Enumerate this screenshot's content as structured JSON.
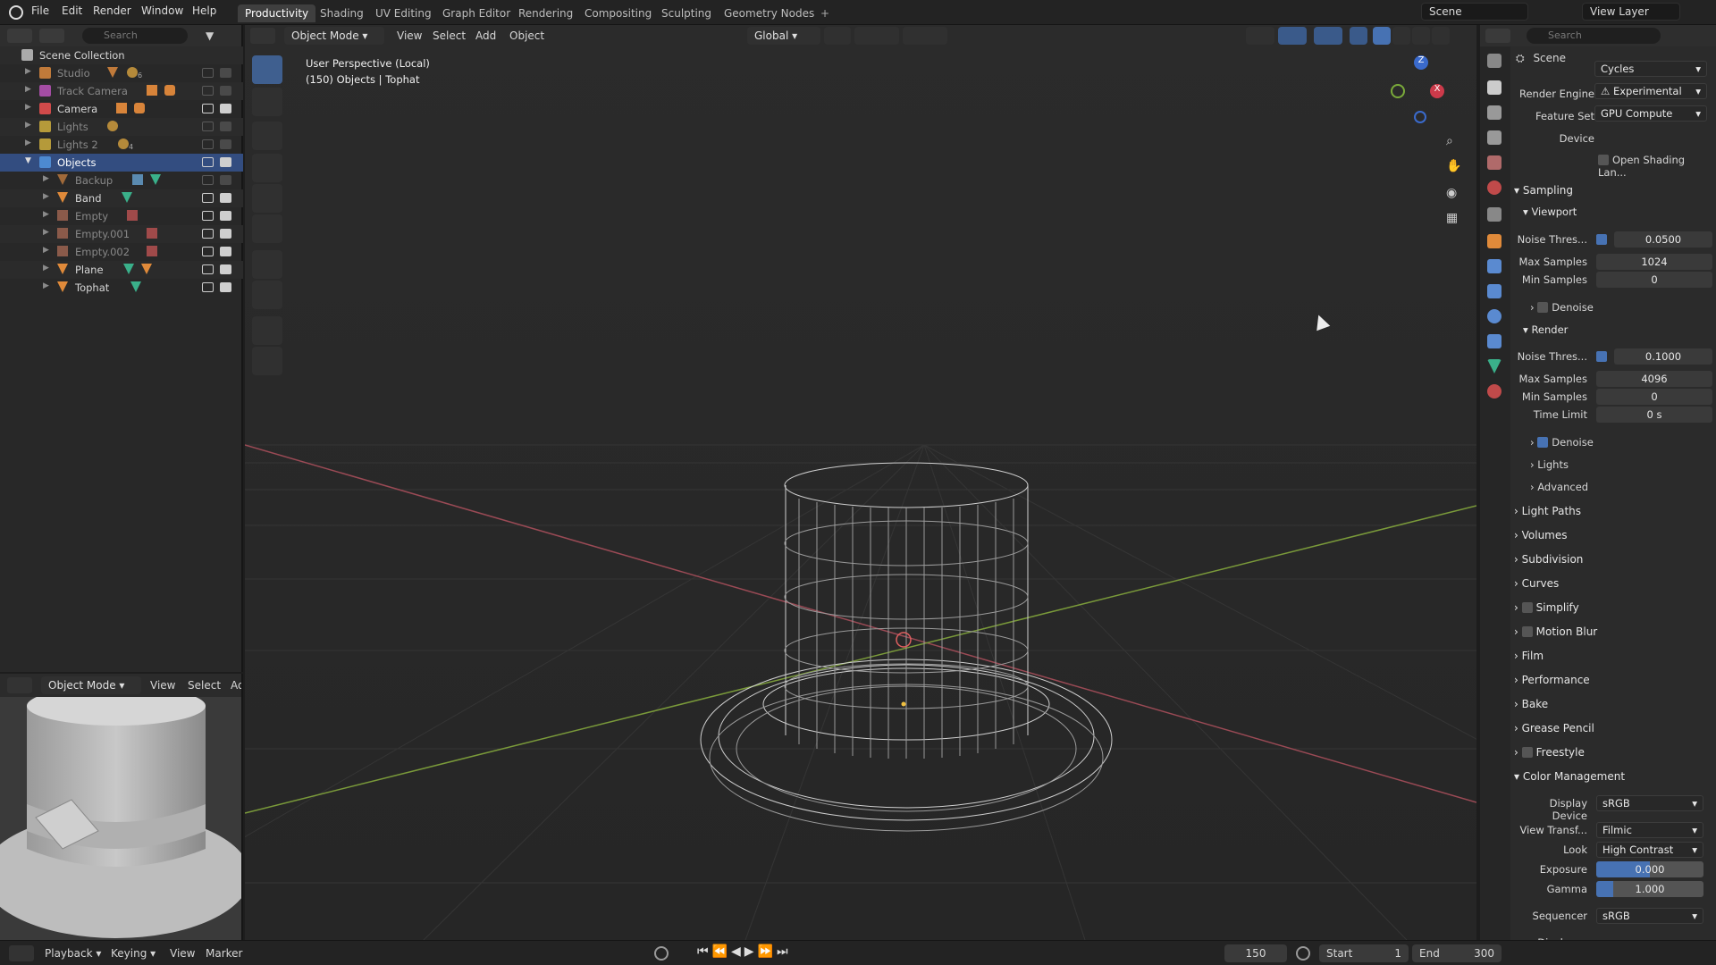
{
  "menu": [
    "File",
    "Edit",
    "Render",
    "Window",
    "Help"
  ],
  "workspaces": [
    "Productivity",
    "Shading",
    "UV Editing",
    "Graph Editor",
    "Rendering",
    "Compositing",
    "Sculpting",
    "Geometry Nodes"
  ],
  "top_right": {
    "scene": "Scene",
    "view_layer": "View Layer"
  },
  "outliner": {
    "search_placeholder": "Search",
    "root": "Scene Collection",
    "collections": [
      {
        "name": "Studio",
        "badge": "6"
      },
      {
        "name": "Track Camera",
        "badge": ""
      },
      {
        "name": "Camera",
        "badge": ""
      },
      {
        "name": "Lights",
        "badge": ""
      },
      {
        "name": "Lights 2",
        "badge": "4"
      },
      {
        "name": "Objects",
        "badge": ""
      }
    ],
    "objects": [
      "Backup",
      "Band",
      "Empty",
      "Empty.001",
      "Empty.002",
      "Plane",
      "Tophat"
    ]
  },
  "mini_view": {
    "mode": "Object Mode",
    "view": "View",
    "select": "Select",
    "add": "Ad"
  },
  "viewport": {
    "mode": "Object Mode",
    "menus": [
      "View",
      "Select",
      "Add",
      "Object"
    ],
    "orientation": "Global",
    "info_line1": "User Perspective (Local)",
    "info_line2": "(150) Objects | Tophat",
    "gizmo": {
      "z": "Z",
      "x": "X"
    }
  },
  "properties": {
    "header": "Scene",
    "search_placeholder": "Search",
    "render_engine_label": "Render Engine",
    "render_engine": "Cycles",
    "feature_set_label": "Feature Set",
    "feature_set": "Experimental",
    "device_label": "Device",
    "device": "GPU Compute",
    "open_shading": "Open Shading Lan...",
    "sampling": "Sampling",
    "viewport": "Viewport",
    "vp_noise_label": "Noise Thres...",
    "vp_noise": "0.0500",
    "vp_max_label": "Max Samples",
    "vp_max": "1024",
    "vp_min_label": "Min Samples",
    "vp_min": "0",
    "denoise": "Denoise",
    "render": "Render",
    "r_noise_label": "Noise Thres...",
    "r_noise": "0.1000",
    "r_max_label": "Max Samples",
    "r_max": "4096",
    "r_min_label": "Min Samples",
    "r_min": "0",
    "time_label": "Time Limit",
    "time": "0 s",
    "r_denoise": "Denoise",
    "lights": "Lights",
    "advanced": "Advanced",
    "sections": [
      "Light Paths",
      "Volumes",
      "Subdivision",
      "Curves",
      "Simplify",
      "Motion Blur",
      "Film",
      "Performance",
      "Bake",
      "Grease Pencil",
      "Freestyle"
    ],
    "color_management": "Color Management",
    "display_device_label": "Display Device",
    "display_device": "sRGB",
    "view_transform_label": "View Transf...",
    "view_transform": "Filmic",
    "look_label": "Look",
    "look": "High Contrast",
    "exposure_label": "Exposure",
    "exposure": "0.000",
    "gamma_label": "Gamma",
    "gamma": "1.000",
    "sequencer_label": "Sequencer",
    "sequencer": "sRGB",
    "display": "Display"
  },
  "timeline": {
    "playback": "Playback",
    "keying": "Keying",
    "view": "View",
    "marker": "Marker",
    "frame": "150",
    "start_label": "Start",
    "start": "1",
    "end_label": "End",
    "end": "300"
  }
}
